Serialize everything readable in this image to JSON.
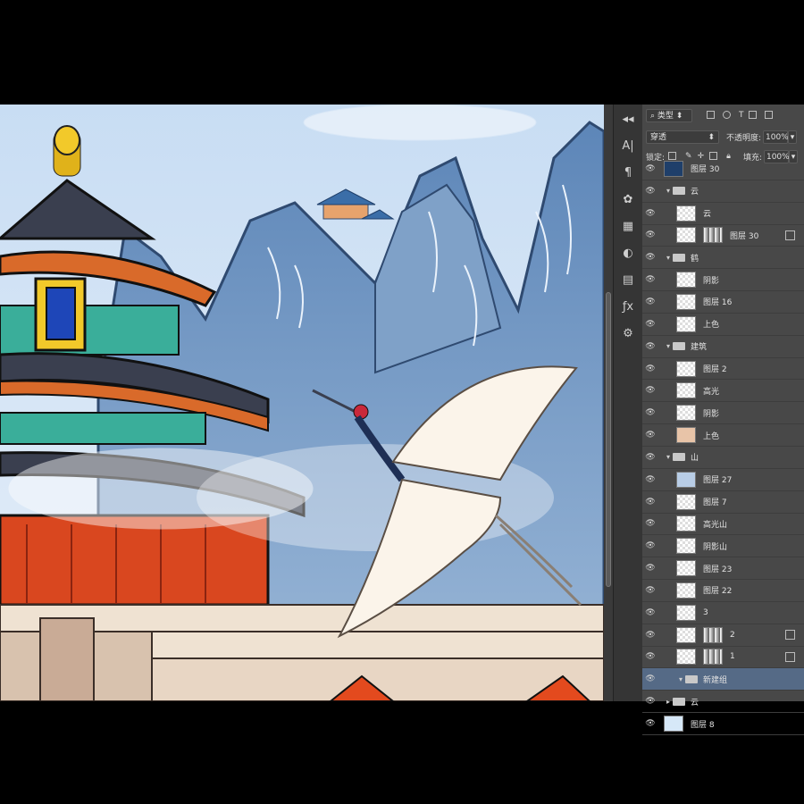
{
  "panel": {
    "filter_label": "类型",
    "blend_mode": "穿透",
    "opacity_label": "不透明度:",
    "opacity_value": "100%",
    "lock_label": "锁定:",
    "fill_label": "填充:",
    "fill_value": "100%"
  },
  "layers": [
    {
      "name": "图层 30",
      "kind": "layer",
      "indent": 0,
      "thumb": "#1f3f6a"
    },
    {
      "name": "云",
      "kind": "group",
      "indent": 0,
      "open": true
    },
    {
      "name": "云",
      "kind": "layer",
      "indent": 1
    },
    {
      "name": "图层 30",
      "kind": "layer",
      "indent": 1,
      "mask": true
    },
    {
      "name": "鹤",
      "kind": "group",
      "indent": 0,
      "open": true
    },
    {
      "name": "阴影",
      "kind": "layer",
      "indent": 1
    },
    {
      "name": "图层 16",
      "kind": "layer",
      "indent": 1
    },
    {
      "name": "上色",
      "kind": "layer",
      "indent": 1
    },
    {
      "name": "建筑",
      "kind": "group",
      "indent": 0,
      "open": true
    },
    {
      "name": "图层 2",
      "kind": "layer",
      "indent": 1
    },
    {
      "name": "高光",
      "kind": "layer",
      "indent": 1
    },
    {
      "name": "阴影",
      "kind": "layer",
      "indent": 1
    },
    {
      "name": "上色",
      "kind": "layer",
      "indent": 1,
      "thumb": "#e8c4a8"
    },
    {
      "name": "山",
      "kind": "group",
      "indent": 0,
      "open": true
    },
    {
      "name": "图层 27",
      "kind": "layer",
      "indent": 1,
      "thumb": "#b8cde6"
    },
    {
      "name": "图层 7",
      "kind": "layer",
      "indent": 1
    },
    {
      "name": "高光山",
      "kind": "layer",
      "indent": 1
    },
    {
      "name": "阴影山",
      "kind": "layer",
      "indent": 1
    },
    {
      "name": "图层 23",
      "kind": "layer",
      "indent": 1
    },
    {
      "name": "图层 22",
      "kind": "layer",
      "indent": 1
    },
    {
      "name": "3",
      "kind": "layer",
      "indent": 1
    },
    {
      "name": "2",
      "kind": "layer",
      "indent": 1,
      "mask": true
    },
    {
      "name": "1",
      "kind": "layer",
      "indent": 1,
      "mask": true
    },
    {
      "name": "新建组",
      "kind": "group",
      "indent": 1,
      "open": true,
      "active": true
    },
    {
      "name": "云",
      "kind": "group",
      "indent": 0,
      "open": false
    },
    {
      "name": "图层 8",
      "kind": "layer",
      "indent": 0,
      "thumb": "#d6e8f8"
    }
  ]
}
